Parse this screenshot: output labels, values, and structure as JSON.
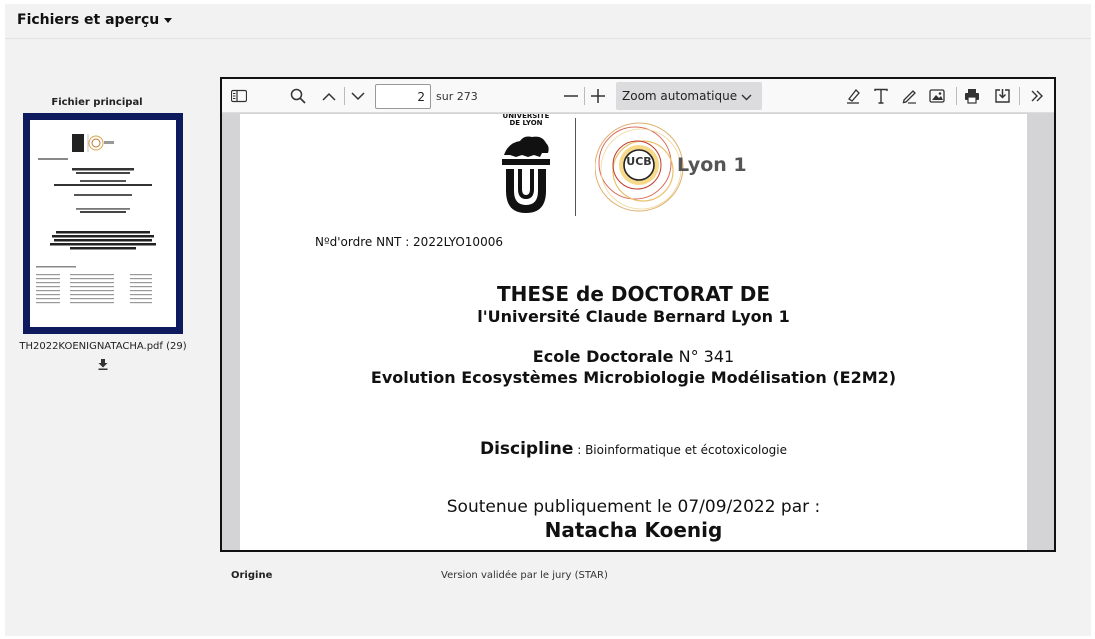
{
  "section": {
    "title": "Fichiers et aperçu"
  },
  "thumbnail": {
    "label": "Fichier principal",
    "filename": "TH2022KOENIGNATACHA.pdf (29)",
    "download_icon": "download-icon"
  },
  "viewer": {
    "page_value": "2",
    "page_total": "sur 273",
    "zoom": "Zoom automatique",
    "icons": [
      "sidebar-toggle-icon",
      "search-icon",
      "chevron-up-icon",
      "chevron-down-icon",
      "zoom-out-icon",
      "zoom-in-icon",
      "highlight-icon",
      "text-icon",
      "draw-icon",
      "image-icon",
      "print-icon",
      "save-icon",
      "more-tools-icon"
    ]
  },
  "document": {
    "logo_univ": "UNIVERSITÉ DE LYON",
    "logo_lyon1": "Lyon 1",
    "logo_ucb": "UCB",
    "nnt": "Nºd'ordre NNT : 2022LYO10006",
    "title": "THESE de DOCTORAT DE",
    "university": "l'Université Claude Bernard Lyon 1",
    "ecole_label": "Ecole Doctorale",
    "ecole_num": "N° 341",
    "ecole_name": "Evolution Ecosystèmes Microbiologie Modélisation (E2M2)",
    "discipline_label": "Discipline",
    "discipline_value": ": Bioinformatique et écotoxicologie",
    "soutenue": "Soutenue publiquement le 07/09/2022 par :",
    "author": "Natacha Koenig"
  },
  "meta": {
    "origine_label": "Origine",
    "origine_value": "Version validée par le jury (STAR)"
  },
  "colors": {
    "thumb_frame": "#0e1a5e",
    "panel_bg": "#f2f2f2",
    "viewer_bg": "#d4d4d7"
  }
}
